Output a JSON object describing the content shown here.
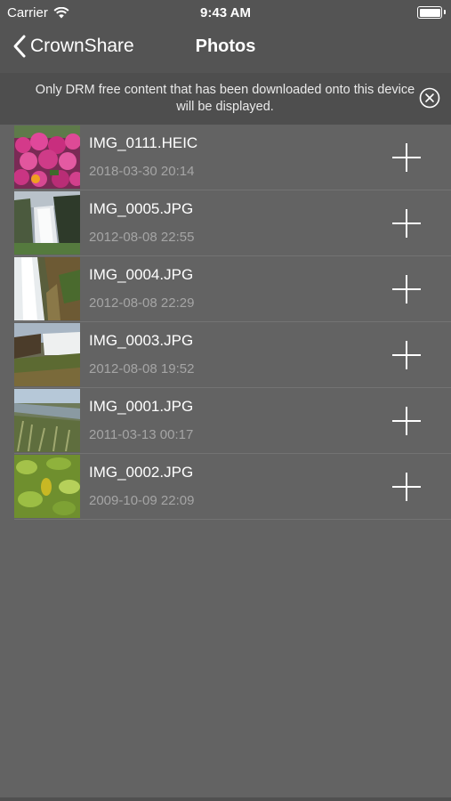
{
  "status": {
    "carrier": "Carrier",
    "time": "9:43 AM"
  },
  "nav": {
    "back_label": "CrownShare",
    "title": "Photos"
  },
  "banner": {
    "message": "Only DRM free content that has been downloaded onto this device will be displayed."
  },
  "photos": [
    {
      "name": "IMG_0111.HEIC",
      "date": "2018-03-30 20:14",
      "thumb": "pink-flowers"
    },
    {
      "name": "IMG_0005.JPG",
      "date": "2012-08-08 22:55",
      "thumb": "waterfall-cliff"
    },
    {
      "name": "IMG_0004.JPG",
      "date": "2012-08-08 22:29",
      "thumb": "waterfall-close"
    },
    {
      "name": "IMG_0003.JPG",
      "date": "2012-08-08 19:52",
      "thumb": "waterfall-wide"
    },
    {
      "name": "IMG_0001.JPG",
      "date": "2011-03-13 00:17",
      "thumb": "hillside-plants"
    },
    {
      "name": "IMG_0002.JPG",
      "date": "2009-10-09 22:09",
      "thumb": "green-leaves"
    }
  ],
  "colors": {
    "background": "#636363",
    "bar": "#545454",
    "banner": "#4e4e4e",
    "date_text": "#a5a5a5"
  }
}
